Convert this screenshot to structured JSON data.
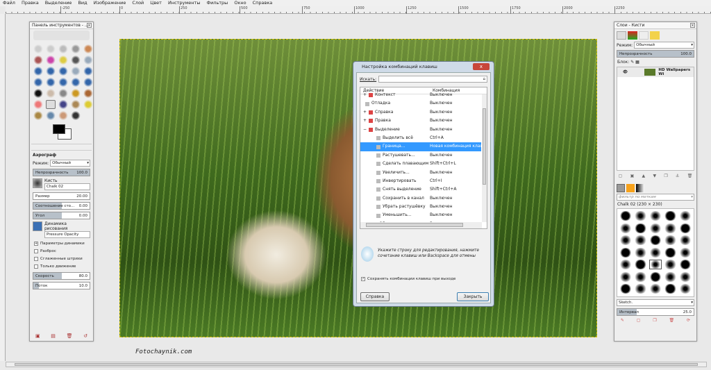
{
  "menu": [
    "Файл",
    "Правка",
    "Выделение",
    "Вид",
    "Изображение",
    "Слой",
    "Цвет",
    "Инструменты",
    "Фильтры",
    "Окно",
    "Справка"
  ],
  "ruler": [
    "-250",
    "0",
    "250",
    "500",
    "750",
    "1000",
    "1250",
    "1500",
    "1750",
    "2000",
    "2250"
  ],
  "toolbox": {
    "title": "Панель инструментов - ...",
    "tool_name": "Аэрограф",
    "mode_label": "Режим:",
    "mode_value": "Обычный",
    "opacity_label": "Непрозрачность",
    "opacity_value": "100.0",
    "brush_label": "Кисть",
    "brush_value": "Chalk 02",
    "size_label": "Размер",
    "size_value": "20.00",
    "ratio_label": "Соотношение сто...",
    "ratio_value": "0.00",
    "angle_label": "Угол",
    "angle_value": "0.00",
    "dynamics_label": "Динамика рисования",
    "dynamics_value": "Pressure Opacity",
    "dynamics_params": "Параметры динамики",
    "scatter": "Разброс",
    "smooth": "Сглаженные штрихи",
    "motion_only": "Только движение",
    "rate_label": "Скорость",
    "rate_value": "80.0",
    "rate_fraction": 0.5,
    "flow_label": "Поток",
    "flow_value": "10.0",
    "flow_fraction": 0.1
  },
  "dialog": {
    "title": "Настройка комбинаций клавиш",
    "search_label": "Искать:",
    "search_value": "",
    "col_action": "Действие",
    "col_shortcut": "Комбинация",
    "rows": [
      {
        "action": "Контекст",
        "shortcut": "Выключен",
        "expander": "+"
      },
      {
        "action": "Отладка",
        "shortcut": "Выключен",
        "expander": ""
      },
      {
        "action": "Справка",
        "shortcut": "Выключен",
        "expander": "+"
      },
      {
        "action": "Правка",
        "shortcut": "Выключен",
        "expander": "+"
      },
      {
        "action": "Выделение",
        "shortcut": "Выключен",
        "expander": "−"
      },
      {
        "action": "Выделить всё",
        "shortcut": "Ctrl+A",
        "expander": ""
      },
      {
        "action": "Граница...",
        "shortcut": "Новая комбинация клав",
        "expander": "",
        "selected": true
      },
      {
        "action": "Растушевать...",
        "shortcut": "Выключен",
        "expander": ""
      },
      {
        "action": "Сделать плавающим",
        "shortcut": "Shift+Ctrl+L",
        "expander": ""
      },
      {
        "action": "Увеличить...",
        "shortcut": "Выключен",
        "expander": ""
      },
      {
        "action": "Инвертировать",
        "shortcut": "Ctrl+I",
        "expander": ""
      },
      {
        "action": "Снять выделение",
        "shortcut": "Shift+Ctrl+A",
        "expander": ""
      },
      {
        "action": "Сохранить в канал",
        "shortcut": "Выключен",
        "expander": ""
      },
      {
        "action": "Убрать растушёвку",
        "shortcut": "Выключен",
        "expander": ""
      },
      {
        "action": "Уменьшить...",
        "shortcut": "Выключен",
        "expander": ""
      },
      {
        "action": "Обвести выделенное...",
        "shortcut": "Выключен",
        "expander": ""
      }
    ],
    "hint": "Укажите строку для редактирования, нажмите сочетание клавиш или Backspace для отмены",
    "save_checkbox": "Сохранять комбинации клавиш при выходе",
    "help_button": "Справка",
    "close_button": "Закрыть"
  },
  "layers": {
    "title": "Слои - Кисти",
    "mode_label": "Режим:",
    "mode_value": "Обычный",
    "opacity_label": "Непрозрачность",
    "opacity_value": "100.0",
    "lock_label": "Блок:",
    "layer_name": "HD Wallpapers Wi",
    "brush_filter_placeholder": "фильтр по меткам",
    "brush_name": "Chalk 02 (230 × 230)",
    "preset": "Sketch.",
    "spacing_label": "Интервал",
    "spacing_value": "25.0"
  },
  "watermark": "Fotochaynik.com",
  "colors": {
    "selection": "#3399ff",
    "fg": "#000000",
    "bg": "#ffffff"
  }
}
